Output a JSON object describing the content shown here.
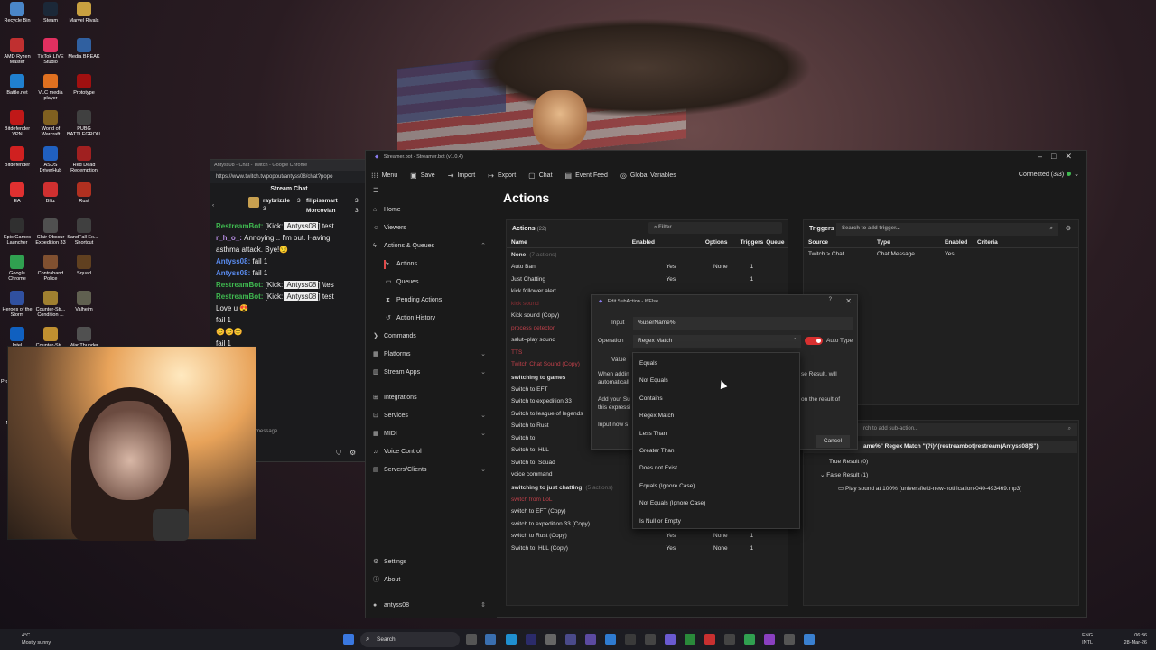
{
  "desktop": {
    "icons": [
      {
        "label": "Recycle Bin",
        "color": "#4a86c8"
      },
      {
        "label": "Steam",
        "color": "#1b2838"
      },
      {
        "label": "Marvel Rivals",
        "color": "#c8a040"
      },
      {
        "label": "AMD Ryzen Master",
        "color": "#c03030"
      },
      {
        "label": "TikTok LIVE Studio",
        "color": "#e03060"
      },
      {
        "label": "Media BREAK",
        "color": "#3060a0"
      },
      {
        "label": "Battle.net",
        "color": "#2080d0"
      },
      {
        "label": "VLC media player",
        "color": "#e07020"
      },
      {
        "label": "Prototype",
        "color": "#a01010"
      },
      {
        "label": "Bitdefender VPN",
        "color": "#c01818"
      },
      {
        "label": "World of Warcraft",
        "color": "#806020"
      },
      {
        "label": "PUBG BATTLEGROU...",
        "color": "#404040"
      },
      {
        "label": "Bitdefender",
        "color": "#d02020"
      },
      {
        "label": "ASUS DriverHub",
        "color": "#2060c0"
      },
      {
        "label": "Red Dead Redemption",
        "color": "#a02020"
      },
      {
        "label": "EA",
        "color": "#e03030"
      },
      {
        "label": "Blitz",
        "color": "#d03030"
      },
      {
        "label": "Rust",
        "color": "#b03020"
      },
      {
        "label": "Epic Games Launcher",
        "color": "#303030"
      },
      {
        "label": "Clair Obscur Expedition 33",
        "color": "#505050"
      },
      {
        "label": "SandFall Ex... - Shortcut",
        "color": "#404040"
      },
      {
        "label": "Google Chrome",
        "color": "#30a050"
      },
      {
        "label": "Contraband Police",
        "color": "#805030"
      },
      {
        "label": "Squad",
        "color": "#604020"
      },
      {
        "label": "Heroes of the Storm",
        "color": "#3050a0"
      },
      {
        "label": "Counter-Str... Condition ...",
        "color": "#a08030"
      },
      {
        "label": "Valheim",
        "color": "#606050"
      },
      {
        "label": "Intel",
        "color": "#1060c0"
      },
      {
        "label": "Counter-Str...",
        "color": "#c09030"
      },
      {
        "label": "War Thunder",
        "color": "#505050"
      },
      {
        "label": "Process Lasso",
        "color": "#30a030"
      },
      {
        "label": "Hogwarts Legacy",
        "color": "#403020"
      },
      {
        "label": "Riot Client",
        "color": "#d02030"
      },
      {
        "label": "Holdfast Nations ...",
        "color": "#605040"
      }
    ]
  },
  "chrome": {
    "title": "Antyss08 - Chat - Twitch - Google Chrome",
    "url": "https://www.twitch.tv/popout/antyss08/chat?popo",
    "stream_chat": "Stream Chat",
    "gifters": [
      {
        "name": "raybrizzle",
        "count": "3"
      },
      {
        "name": "filipissmart",
        "count": "3"
      },
      {
        "name": "Morcovian",
        "count": "3"
      }
    ],
    "gift_count": "3",
    "messages": [
      {
        "user": "RestreamBot:",
        "color": "#3fb950",
        "pre": "[Kick: ",
        "hl": "Antyss08",
        "post": "] test"
      },
      {
        "user": "r_h_o_:",
        "color": "#b58ce0",
        "text": "Annoying... I'm out. Having"
      },
      {
        "text": "asthma attack. Bye!😏"
      },
      {
        "user": "Antyss08:",
        "color": "#5a8cf0",
        "text": "fail 1"
      },
      {
        "user": "Antyss08:",
        "color": "#5a8cf0",
        "text": "fail 1"
      },
      {
        "user": "RestreamBot:",
        "color": "#3fb950",
        "pre": "[Kick: ",
        "hl": "Antyss08",
        "post": "] \\tes"
      },
      {
        "user": "RestreamBot:",
        "color": "#3fb950",
        "pre": "[Kick: ",
        "hl": "Antyss08",
        "post": "] test"
      },
      {
        "text": "Love u 😍"
      },
      {
        "text": "fail 1"
      },
      {
        "text": "😊😊😊"
      },
      {
        "text": "fail 1"
      },
      {
        "text": "fail 1"
      }
    ],
    "input_placeholder": "message"
  },
  "sb": {
    "title": "Streamer.bot - Streamer.bot (v1.0.4)",
    "toolbar": {
      "menu": "Menu",
      "save": "Save",
      "import": "Import",
      "export": "Export",
      "chat": "Chat",
      "event_feed": "Event Feed",
      "global_variables": "Global Variables",
      "connected": "Connected (3/3)"
    },
    "nav": {
      "home": "Home",
      "viewers": "Viewers",
      "actions_queues": "Actions & Queues",
      "actions": "Actions",
      "queues": "Queues",
      "pending": "Pending Actions",
      "history": "Action History",
      "commands": "Commands",
      "platforms": "Platforms",
      "stream_apps": "Stream Apps",
      "integrations": "Integrations",
      "services": "Services",
      "midi": "MIDI",
      "voice": "Voice Control",
      "servers": "Servers/Clients",
      "settings": "Settings",
      "about": "About",
      "user": "antyss08"
    },
    "page_title": "Actions",
    "actions": {
      "label": "Actions",
      "count": "(22)",
      "filter_placeholder": "Filter",
      "columns": {
        "name": "Name",
        "enabled": "Enabled",
        "options": "Options",
        "triggers": "Triggers",
        "queue": "Queue"
      },
      "groups": [
        {
          "name": "None",
          "count": "(7 actions)",
          "rows": [
            {
              "name": "Auto Ban",
              "enabled": "Yes",
              "options": "None",
              "triggers": "1",
              "cls": ""
            },
            {
              "name": "Just Chatting",
              "enabled": "Yes",
              "options": "",
              "triggers": "1",
              "cls": ""
            },
            {
              "name": "kick follower alert",
              "enabled": "",
              "options": "",
              "triggers": "",
              "cls": ""
            },
            {
              "name": "kick sound",
              "enabled": "",
              "options": "",
              "triggers": "",
              "cls": "redd"
            },
            {
              "name": "Kick sound (Copy)",
              "enabled": "",
              "options": "",
              "triggers": "",
              "cls": ""
            },
            {
              "name": "process detector",
              "enabled": "",
              "options": "",
              "triggers": "",
              "cls": "red"
            },
            {
              "name": "salut=play sound",
              "enabled": "",
              "options": "",
              "triggers": "",
              "cls": ""
            },
            {
              "name": "TTS",
              "enabled": "",
              "options": "",
              "triggers": "",
              "cls": "red"
            },
            {
              "name": "Twitch Chat Sound (Copy)",
              "enabled": "",
              "options": "",
              "triggers": "",
              "cls": "red"
            }
          ]
        },
        {
          "name": "switching to games",
          "count": "",
          "rows": [
            {
              "name": "Switch to EFT",
              "enabled": "",
              "options": "",
              "triggers": "",
              "cls": ""
            },
            {
              "name": "Switch to expedition 33",
              "enabled": "",
              "options": "",
              "triggers": "",
              "cls": ""
            },
            {
              "name": "Switch to league of legends",
              "enabled": "",
              "options": "",
              "triggers": "",
              "cls": ""
            },
            {
              "name": "Switch to Rust",
              "enabled": "",
              "options": "",
              "triggers": "",
              "cls": ""
            },
            {
              "name": "Switch to:",
              "enabled": "",
              "options": "",
              "triggers": "",
              "cls": ""
            },
            {
              "name": "Switch to: HLL",
              "enabled": "",
              "options": "",
              "triggers": "",
              "cls": ""
            },
            {
              "name": "Switch to: Squad",
              "enabled": "",
              "options": "",
              "triggers": "",
              "cls": ""
            },
            {
              "name": "voice command",
              "enabled": "",
              "options": "",
              "triggers": "",
              "cls": ""
            }
          ]
        },
        {
          "name": "switching to just chatting",
          "count": "(5 actions)",
          "rows": [
            {
              "name": "switch from LoL",
              "enabled": "",
              "options": "",
              "triggers": "",
              "cls": "red"
            },
            {
              "name": "switch to EFT (Copy)",
              "enabled": "Yes",
              "options": "None",
              "triggers": "1",
              "cls": ""
            },
            {
              "name": "switch to expedition 33 (Copy)",
              "enabled": "Yes",
              "options": "AR",
              "triggers": "1",
              "cls": ""
            },
            {
              "name": "switch to Rust (Copy)",
              "enabled": "Yes",
              "options": "None",
              "triggers": "1",
              "cls": ""
            },
            {
              "name": "Switch to: HLL (Copy)",
              "enabled": "Yes",
              "options": "None",
              "triggers": "1",
              "cls": ""
            }
          ]
        }
      ]
    },
    "triggers": {
      "label": "Triggers",
      "search_placeholder": "Search to add trigger...",
      "columns": {
        "source": "Source",
        "type": "Type",
        "enabled": "Enabled",
        "criteria": "Criteria"
      },
      "rows": [
        {
          "source": "Twitch > Chat",
          "type": "Chat Message",
          "enabled": "Yes",
          "criteria": ""
        }
      ]
    },
    "subactions": {
      "search_placeholder": "rch to add sub-action...",
      "if_line": "ame%\" Regex Match \"(?i)^(restreambot|restream(Antyss08)$\")",
      "true_result": "True Result (0)",
      "false_result": "False Result (1)",
      "play_sound": "Play sound at 100% (universfield-new-notification-040-493469.mp3)"
    }
  },
  "dialog": {
    "title": "Edit SubAction - If/Else",
    "help": "?",
    "input_label": "Input",
    "input_value": "%userName%",
    "operation_label": "Operation",
    "operation_value": "Regex Match",
    "auto_type": "Auto Type",
    "value_label": "Value",
    "note1": "When addin",
    "note2": "automaticall",
    "note3": "Add your Su",
    "note4": "this expressi",
    "note5": "Input now s",
    "right1": "se Result, will",
    "right2": "on the result of",
    "cancel": "Cancel",
    "options": [
      "Equals",
      "Not Equals",
      "Contains",
      "Regex Match",
      "Less Than",
      "Greater Than",
      "Does not Exist",
      "Equals (Ignore Case)",
      "Not Equals (Ignore Case)",
      "Is Null or Empty"
    ]
  },
  "taskbar": {
    "weather_temp": "4°C",
    "weather_desc": "Mostly sunny",
    "search": "Search",
    "lang1": "ENG",
    "lang2": "INTL",
    "time": "06:36",
    "date": "28-Mar-26"
  }
}
